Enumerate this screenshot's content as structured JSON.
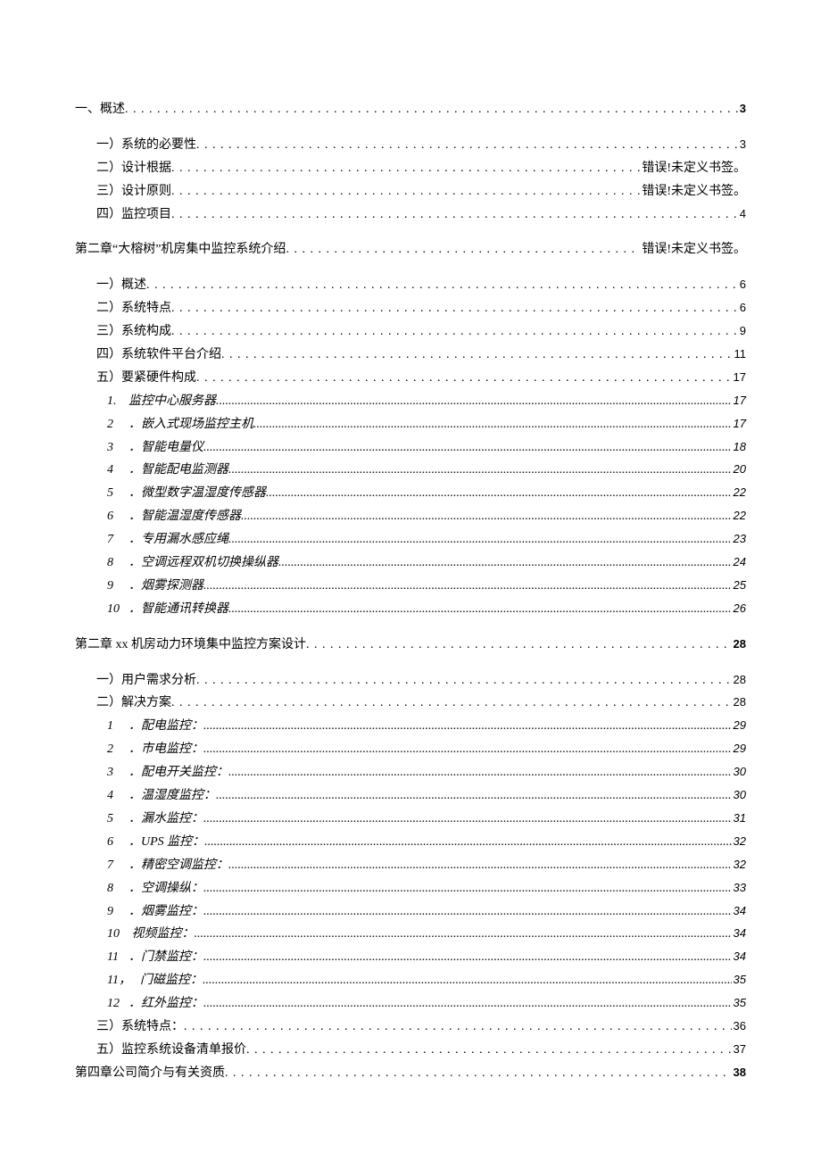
{
  "toc": [
    {
      "level": 0,
      "label": "一、概述",
      "page": "3",
      "bold": true,
      "spacer": false
    },
    {
      "level": 1,
      "label": "一）系统的必要性",
      "page": "3",
      "spacer": true
    },
    {
      "level": 1,
      "label": "二）设计根据",
      "page_err": "错误!未定义书签。"
    },
    {
      "level": 1,
      "label": "三）设计原则",
      "page_err": "错误!未定义书签。"
    },
    {
      "level": 1,
      "label": "四）监控项目",
      "page": "4"
    },
    {
      "level": 0,
      "label": "第二章“大榕树”机房集中监控系统介绍",
      "page_err": "错误!未定义书签。",
      "bold": true,
      "spacer": true
    },
    {
      "level": 1,
      "label": "一）概述",
      "page": "6",
      "spacer": true
    },
    {
      "level": 1,
      "label": "二）系统特点",
      "page": "6"
    },
    {
      "level": 1,
      "label": "三）系统构成",
      "page": "9"
    },
    {
      "level": 1,
      "label": "四）系统软件平台介绍",
      "page": "11"
    },
    {
      "level": 1,
      "label": "五）要紧硬件构成",
      "page": "17"
    },
    {
      "level": 2,
      "italic": true,
      "num": "1.",
      "label": "监控中心服务器",
      "page": "17"
    },
    {
      "level": 2,
      "italic": true,
      "num": "2",
      "label": "．嵌入式现场监控主机",
      "page": "17"
    },
    {
      "level": 2,
      "italic": true,
      "num": "3",
      "label": "．智能电量仪",
      "page": "18"
    },
    {
      "level": 2,
      "italic": true,
      "num": "4",
      "label": "．智能配电监测器",
      "page": "20"
    },
    {
      "level": 2,
      "italic": true,
      "num": "5",
      "label": "．微型数字温湿度传感器",
      "page": "22"
    },
    {
      "level": 2,
      "italic": true,
      "num": "6",
      "label": "．智能温湿度传感器",
      "page": "22"
    },
    {
      "level": 2,
      "italic": true,
      "num": "7",
      "label": "．专用漏水感应绳",
      "page": "23"
    },
    {
      "level": 2,
      "italic": true,
      "num": "8",
      "label": "．空调远程双机切换操纵器",
      "page": "24"
    },
    {
      "level": 2,
      "italic": true,
      "num": "9",
      "label": "．烟雾探测器",
      "page": "25"
    },
    {
      "level": 2,
      "italic": true,
      "num": "10",
      "label": "．智能通讯转换器",
      "page": "26"
    },
    {
      "level": 0,
      "label": "第二章 xx 机房动力环境集中监控方案设计",
      "page": "28",
      "bold": true,
      "spacer": true
    },
    {
      "level": 1,
      "label": "一）用户需求分析",
      "page": "28",
      "spacer": true
    },
    {
      "level": 1,
      "label": "二）解决方案",
      "page": "28"
    },
    {
      "level": 2,
      "italic": true,
      "num": "1",
      "label": "．配电监控：",
      "page": "29"
    },
    {
      "level": 2,
      "italic": true,
      "num": "2",
      "label": "．市电监控：",
      "page": "29"
    },
    {
      "level": 2,
      "italic": true,
      "num": "3",
      "label": "．配电开关监控：",
      "page": "30"
    },
    {
      "level": 2,
      "italic": true,
      "num": "4",
      "label": "．温湿度监控：",
      "page": "30"
    },
    {
      "level": 2,
      "italic": true,
      "num": "5",
      "label": "．漏水监控：",
      "page": "31"
    },
    {
      "level": 2,
      "italic": true,
      "num": "6",
      "label": "．UPS 监控：",
      "page": "32"
    },
    {
      "level": 2,
      "italic": true,
      "num": "7",
      "label": "．精密空调监控：",
      "page": "32"
    },
    {
      "level": 2,
      "italic": true,
      "num": "8",
      "label": "．空调操纵：",
      "page": "33"
    },
    {
      "level": 2,
      "italic": true,
      "num": "9",
      "label": "．烟雾监控：",
      "page": "34"
    },
    {
      "level": 2,
      "italic": true,
      "num": "10",
      "label": " 视频监控：",
      "page": "34"
    },
    {
      "level": 2,
      "italic": true,
      "num": "11",
      "label": "．门禁监控：",
      "page": "34"
    },
    {
      "level": 2,
      "italic": true,
      "num": "11，",
      "label": "门磁监控：",
      "page": "35"
    },
    {
      "level": 2,
      "italic": true,
      "num": "12",
      "label": "．红外监控：",
      "page": "35"
    },
    {
      "level": 1,
      "label": "三）系统特点：",
      "page": "36"
    },
    {
      "level": 1,
      "label": "五）监控系统设备清单报价",
      "page": "37"
    },
    {
      "level": 0,
      "label": "第四章公司简介与有关资质",
      "page": "38",
      "bold": true
    }
  ]
}
